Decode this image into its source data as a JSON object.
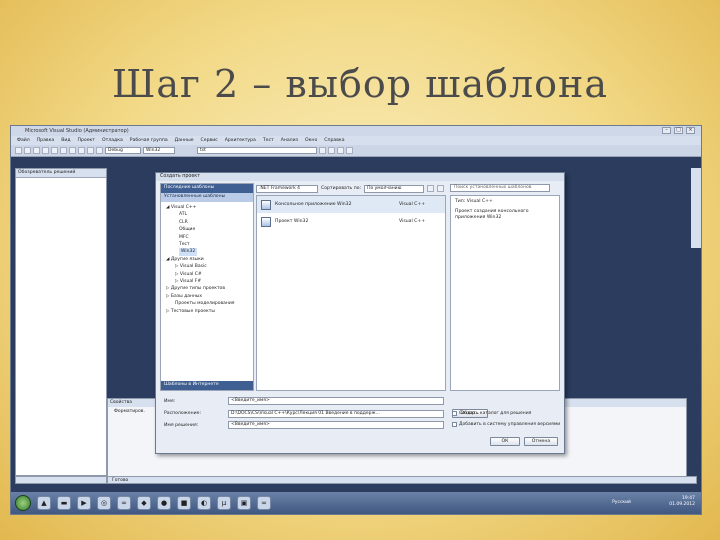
{
  "slide_title": "Шаг 2 – выбор шаблона",
  "window": {
    "title": "Microsoft Visual Studio (Администратор)",
    "menu": [
      "Файл",
      "Правка",
      "Вид",
      "Проект",
      "Отладка",
      "Рабочая группа",
      "Данные",
      "Сервис",
      "Архитектура",
      "Тест",
      "Анализ",
      "Окно",
      "Справка"
    ],
    "toolbar_config": "Debug",
    "toolbar_platform": "Win32",
    "toolbar_target": "tst"
  },
  "solution_explorer": {
    "title": "Обозреватель решений"
  },
  "properties_panel": {
    "title": "Свойства",
    "row": "Форматиров."
  },
  "status_bar": {
    "text": "Готово"
  },
  "dialog": {
    "title": "Создать проект",
    "recent_templates": "Последние шаблоны",
    "installed_templates": "Установленные шаблоны",
    "framework": ".NET Framework 4",
    "sort_label": "Сортировать по:",
    "sort_value": "По умолчанию",
    "search_placeholder": "Поиск установленных шаблонов",
    "tree": [
      {
        "label": "Visual C++",
        "level": 0,
        "expanded": true
      },
      {
        "label": "ATL",
        "level": 1
      },
      {
        "label": "CLR",
        "level": 1
      },
      {
        "label": "Общие",
        "level": 1
      },
      {
        "label": "MFC",
        "level": 1
      },
      {
        "label": "Тест",
        "level": 1
      },
      {
        "label": "Win32",
        "level": 1,
        "selected": true
      },
      {
        "label": "Другие языки",
        "level": 0,
        "expanded": true
      },
      {
        "label": "Visual Basic",
        "level": 1
      },
      {
        "label": "Visual C#",
        "level": 1
      },
      {
        "label": "Visual F#",
        "level": 1
      },
      {
        "label": "Другие типы проектов",
        "level": 0
      },
      {
        "label": "Базы данных",
        "level": 0
      },
      {
        "label": "Проекты моделирования",
        "level": 1
      },
      {
        "label": "Тестовые проекты",
        "level": 0
      }
    ],
    "online_templates": "Шаблоны в Интернете",
    "templates": [
      {
        "name": "Консольное приложение Win32",
        "lang": "Visual C++",
        "selected": true
      },
      {
        "name": "Проект Win32",
        "lang": "Visual C++"
      }
    ],
    "details": {
      "type": "Тип: Visual C++",
      "description": "Проект создания консольного приложения Win32"
    },
    "fields": {
      "name_label": "Имя:",
      "name_value": "<Введите_имя>",
      "location_label": "Расположение:",
      "location_value": "D:\\DOCS\\CS\\Visual C++\\Курс\\Лекция 01 Введение в поддерж...",
      "solution_label": "Имя решения:",
      "solution_value": "<Введите_имя>"
    },
    "browse_button": "Обзор...",
    "check_create_dir": "Создать каталог для решения",
    "check_source_control": "Добавить в систему управления версиями",
    "ok_button": "ОК",
    "cancel_button": "Отмена"
  },
  "taskbar": {
    "lang": "Русский",
    "time": "19:47",
    "date": "01.09.2012"
  }
}
